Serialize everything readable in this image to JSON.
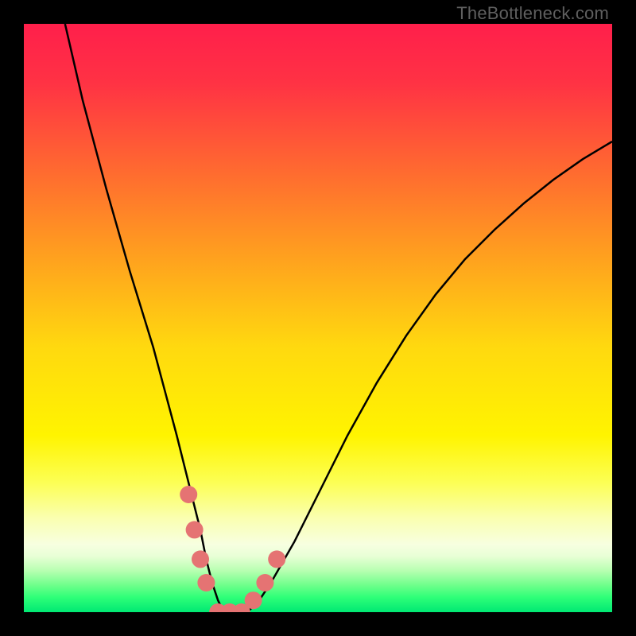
{
  "watermark": "TheBottleneck.com",
  "chart_data": {
    "type": "line",
    "title": "",
    "xlabel": "",
    "ylabel": "",
    "xlim": [
      0,
      100
    ],
    "ylim": [
      0,
      100
    ],
    "grid": false,
    "legend": false,
    "series": [
      {
        "name": "bottleneck-curve",
        "x": [
          7,
          10,
          14,
          18,
          22,
          26,
          28,
          30,
          31,
          32,
          33,
          34,
          35,
          36,
          38,
          40,
          42,
          46,
          50,
          55,
          60,
          65,
          70,
          75,
          80,
          85,
          90,
          95,
          100
        ],
        "y": [
          100,
          87,
          72,
          58,
          45,
          30,
          22,
          14,
          9,
          5,
          2,
          0,
          0,
          0,
          0,
          2,
          5,
          12,
          20,
          30,
          39,
          47,
          54,
          60,
          65,
          69.5,
          73.5,
          77,
          80
        ],
        "stroke": "#000000"
      }
    ],
    "markers": [
      {
        "x": 28,
        "y": 20,
        "color": "#e57373"
      },
      {
        "x": 29,
        "y": 14,
        "color": "#e57373"
      },
      {
        "x": 30,
        "y": 9,
        "color": "#e57373"
      },
      {
        "x": 31,
        "y": 5,
        "color": "#e57373"
      },
      {
        "x": 33,
        "y": 0,
        "color": "#e57373"
      },
      {
        "x": 35,
        "y": 0,
        "color": "#e57373"
      },
      {
        "x": 37,
        "y": 0,
        "color": "#e57373"
      },
      {
        "x": 39,
        "y": 2,
        "color": "#e57373"
      },
      {
        "x": 41,
        "y": 5,
        "color": "#e57373"
      },
      {
        "x": 43,
        "y": 9,
        "color": "#e57373"
      }
    ],
    "gradient_stops": [
      {
        "offset": 0.0,
        "color": "#ff1f4b"
      },
      {
        "offset": 0.1,
        "color": "#ff3244"
      },
      {
        "offset": 0.25,
        "color": "#ff6a30"
      },
      {
        "offset": 0.4,
        "color": "#ffa21e"
      },
      {
        "offset": 0.55,
        "color": "#ffd90f"
      },
      {
        "offset": 0.7,
        "color": "#fff400"
      },
      {
        "offset": 0.78,
        "color": "#fcff55"
      },
      {
        "offset": 0.84,
        "color": "#faffb0"
      },
      {
        "offset": 0.885,
        "color": "#f7ffe0"
      },
      {
        "offset": 0.905,
        "color": "#e8ffd6"
      },
      {
        "offset": 0.93,
        "color": "#b6ffb0"
      },
      {
        "offset": 0.955,
        "color": "#6cff8a"
      },
      {
        "offset": 0.975,
        "color": "#2eff78"
      },
      {
        "offset": 1.0,
        "color": "#00e873"
      }
    ]
  }
}
